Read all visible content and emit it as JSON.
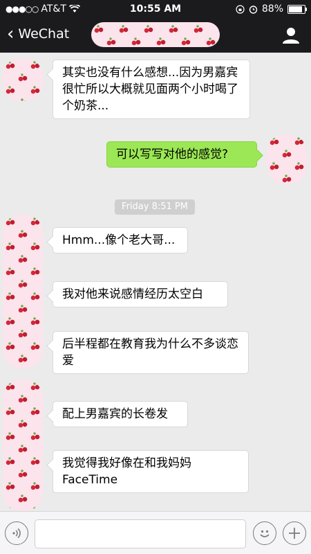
{
  "status_bar": {
    "carrier": "AT&T",
    "signal": "●●●○○",
    "time": "10:55 AM",
    "battery": "88%",
    "battery_level": 0.88
  },
  "nav": {
    "back_label": "WeChat",
    "back_icon": "chevron-left-icon",
    "contact_icon": "person-icon"
  },
  "messages": [
    {
      "side": "left",
      "text": "其实也没有什么感想...因为男嘉宾很忙所以大概就见面两个小时喝了个奶茶..."
    },
    {
      "side": "right",
      "text": "可以写写对他的感觉?"
    },
    {
      "type": "time",
      "text": "Friday 8:51 PM"
    },
    {
      "side": "left",
      "text": "Hmm...像个老大哥..."
    },
    {
      "side": "left",
      "text": "我对他来说感情经历太空白"
    },
    {
      "side": "left",
      "text": "后半程都在教育我为什么不多谈恋爱"
    },
    {
      "side": "left",
      "text": "配上男嘉宾的长卷发"
    },
    {
      "side": "left",
      "text": "我觉得我好像在和我妈妈FaceTime"
    }
  ],
  "input_bar": {
    "voice_icon": "voice-icon",
    "emoji_icon": "emoji-icon",
    "add_icon": "plus-icon",
    "text_value": ""
  },
  "colors": {
    "nav_bg": "#1b1b1e",
    "chat_bg": "#ebebeb",
    "sent_bubble": "#9ce755",
    "received_bubble": "#ffffff"
  }
}
